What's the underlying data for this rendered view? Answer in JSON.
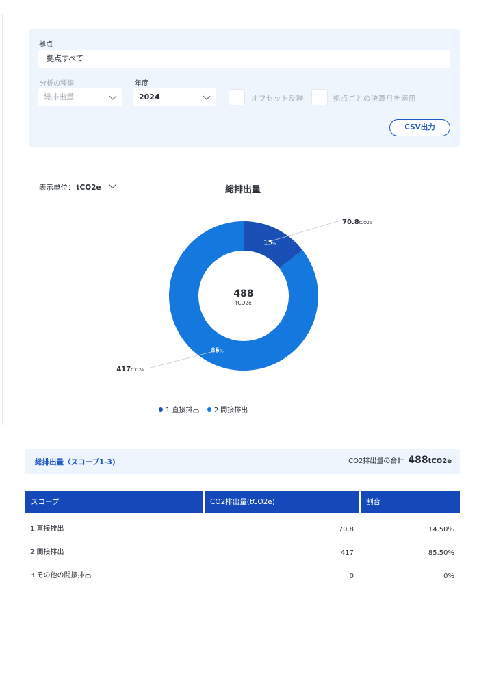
{
  "filters": {
    "site_label": "拠点",
    "site_value": "拠点すべて",
    "analysis_label": "分析の種類",
    "analysis_value": "総排出量",
    "year_label": "年度",
    "year_value": "2024",
    "offset_label": "オフセット反映",
    "fiscal_label": "拠点ごとの決算月を適用",
    "csv_button": "CSV出力"
  },
  "display_unit": {
    "label": "表示単位：",
    "value": "tCO2e"
  },
  "chart_data": {
    "type": "pie",
    "title": "総排出量",
    "center_value": "488",
    "center_unit": "tCO2e",
    "categories": [
      "1 直接排出",
      "2 間接排出"
    ],
    "values": [
      70.8,
      417
    ],
    "percent_labels": [
      "15",
      "85"
    ],
    "percent_symbol": "%",
    "callout_values": [
      "70.8",
      "417"
    ],
    "callout_unit": "tCO2e",
    "colors": [
      "#1a4fb5",
      "#1478de"
    ],
    "legend_position": "bottom"
  },
  "summary": {
    "title": "総排出量（スコープ1-3)",
    "total_label": "CO2排出量の合計",
    "total_value": "488",
    "total_unit": "tCO2e"
  },
  "table": {
    "headers": [
      "スコープ",
      "CO2排出量(tCO2e)",
      "割合"
    ],
    "rows": [
      {
        "scope": "1 直接排出",
        "amount": "70.8",
        "ratio": "14.50%"
      },
      {
        "scope": "2 間接排出",
        "amount": "417",
        "ratio": "85.50%"
      },
      {
        "scope": "3 その他の間接排出",
        "amount": "0",
        "ratio": "0%"
      }
    ]
  },
  "colors": {
    "accent": "#1b57c5",
    "header_bg": "#1548b8",
    "panel_bg": "#eef5fc"
  }
}
